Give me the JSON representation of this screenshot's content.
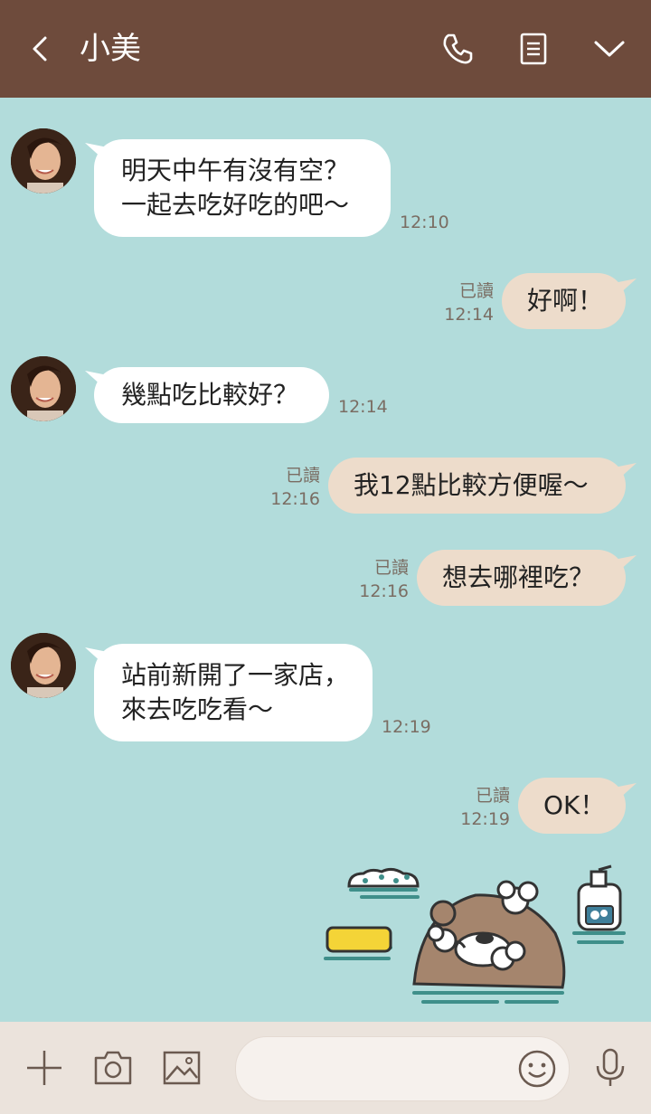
{
  "header": {
    "title": "小美",
    "background": "#6e4b3c",
    "icons": [
      "back-arrow-icon",
      "phone-icon",
      "notes-icon",
      "chevron-down-icon"
    ]
  },
  "chat": {
    "background": "#b2dcdb",
    "messages": [
      {
        "dir": "in",
        "lines": "明天中午有沒有空？\n一起去吃好吃的吧～",
        "time": "12:10"
      },
      {
        "dir": "out",
        "lines": "好啊！",
        "read": "已讀",
        "time": "12:14"
      },
      {
        "dir": "in",
        "lines": "幾點吃比較好？",
        "time": "12:14"
      },
      {
        "dir": "out",
        "lines": "我12點比較方便喔～",
        "read": "已讀",
        "time": "12:16"
      },
      {
        "dir": "out",
        "lines": "想去哪裡吃？",
        "read": "已讀",
        "time": "12:16"
      },
      {
        "dir": "in",
        "lines": "站前新開了一家店，\n來去吃吃看～",
        "time": "12:19"
      },
      {
        "dir": "out",
        "lines": "OK！",
        "read": "已讀",
        "time": "12:19"
      }
    ],
    "sticker": "otter-bath-sticker"
  },
  "input_bar": {
    "placeholder": "",
    "icons": [
      "plus-icon",
      "camera-icon",
      "image-icon",
      "emoji-icon",
      "microphone-icon"
    ]
  },
  "colors": {
    "incoming_bubble": "#ffffff",
    "outgoing_bubble": "#eddccb",
    "meta_text": "#7a6d63"
  }
}
